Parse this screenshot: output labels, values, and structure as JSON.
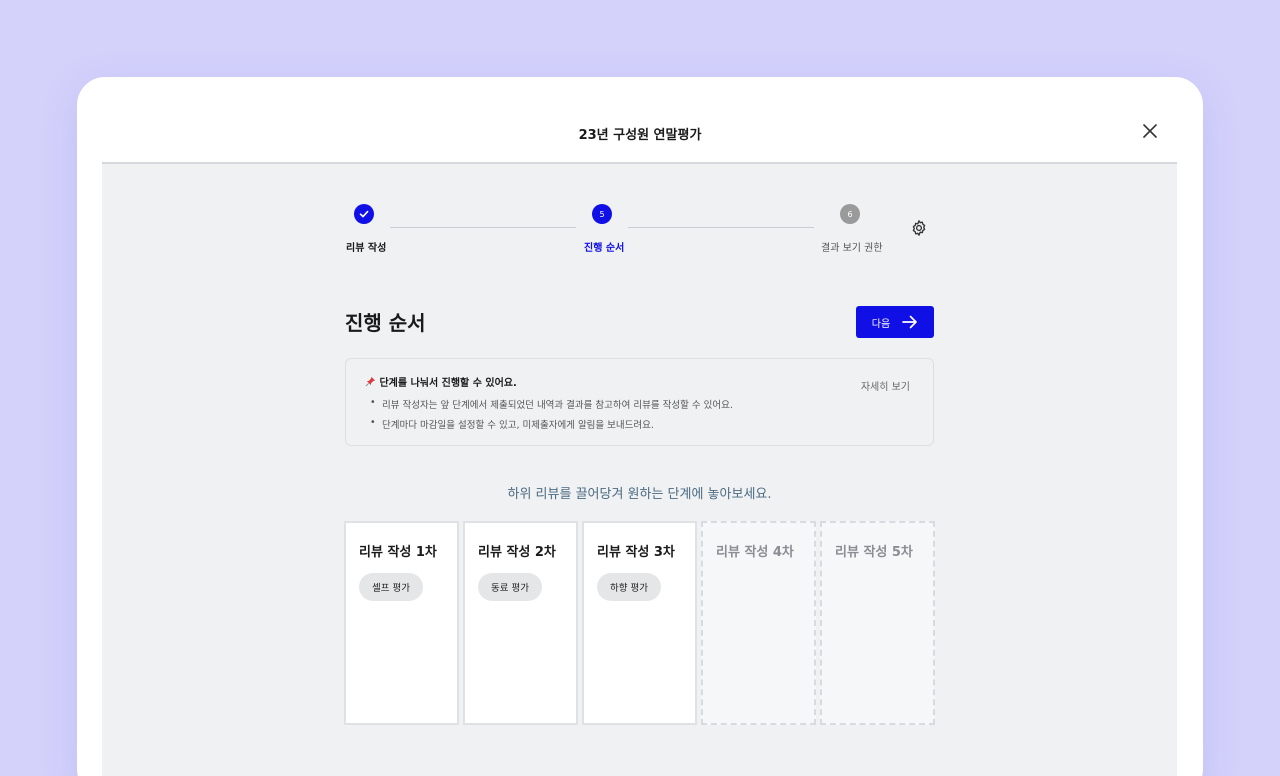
{
  "window": {
    "title": "23년 구성원 연말평가"
  },
  "stepper": {
    "steps": [
      {
        "label": "리뷰 작성",
        "number": "",
        "state": "done",
        "color": "#1010e6"
      },
      {
        "label": "진행 순서",
        "number": "5",
        "state": "current",
        "color": "#1010e6"
      },
      {
        "label": "결과 보기 권한",
        "number": "6",
        "state": "upcoming",
        "color": "#9a9a9a"
      }
    ]
  },
  "section": {
    "title": "진행 순서",
    "next_label": "다음"
  },
  "info": {
    "icon": "pin-icon",
    "heading": "단계를 나눠서 진행할 수 있어요.",
    "detail_link": "자세히 보기",
    "bullets": [
      "리뷰 작성자는 앞 단계에서 제출되었던 내역과 결과를 참고하여 리뷰를 작성할 수 있어요.",
      "단계마다 마감일을 설정할 수 있고, 미제출자에게 알림을 보내드려요."
    ]
  },
  "hint": "하위 리뷰를 끌어당겨 원하는 단계에 놓아보세요.",
  "cards": [
    {
      "title": "리뷰 작성 1차",
      "chip": "셀프 평가",
      "filled": true
    },
    {
      "title": "리뷰 작성 2차",
      "chip": "동료 평가",
      "filled": true
    },
    {
      "title": "리뷰 작성 3차",
      "chip": "하향 평가",
      "filled": true
    },
    {
      "title": "리뷰 작성 4차",
      "chip": "",
      "filled": false
    },
    {
      "title": "리뷰 작성 5차",
      "chip": "",
      "filled": false
    }
  ],
  "colors": {
    "accent": "#1010e6",
    "background": "#d4d2fb",
    "panel": "#f0f1f3"
  }
}
